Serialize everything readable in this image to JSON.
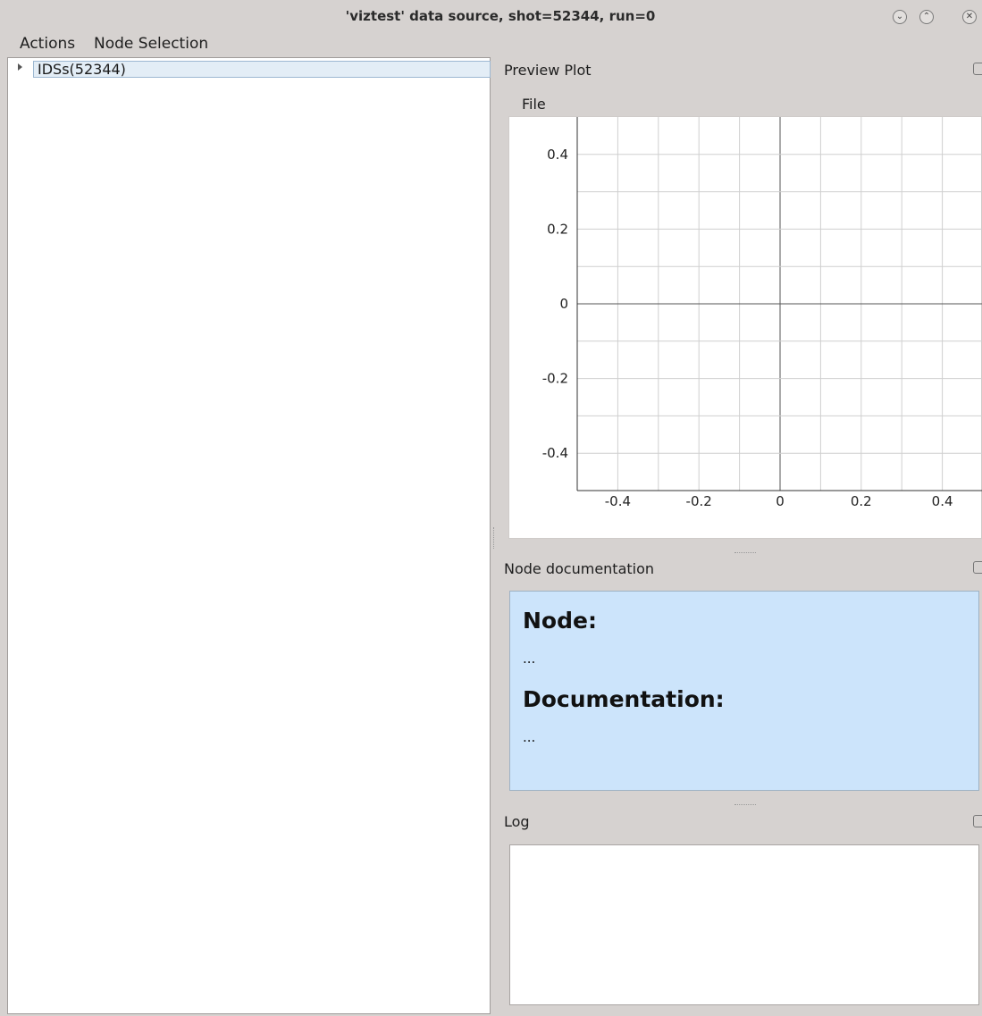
{
  "window": {
    "title": "'viztest' data source, shot=52344, run=0",
    "buttons": [
      "minimize",
      "maximize",
      "close"
    ]
  },
  "menubar": {
    "items": [
      "Actions",
      "Node Selection"
    ]
  },
  "tree": {
    "root_label": "IDSs(52344)",
    "expanded": false
  },
  "preview": {
    "title": "Preview Plot",
    "menu_file": "File"
  },
  "chart_data": {
    "type": "line",
    "title": "",
    "xlabel": "",
    "ylabel": "",
    "series": [],
    "xlim": [
      -0.5,
      0.5
    ],
    "ylim": [
      -0.5,
      0.5
    ],
    "x_ticks": [
      -0.4,
      -0.2,
      0,
      0.2,
      0.4
    ],
    "y_ticks": [
      -0.4,
      -0.2,
      0,
      0.2,
      0.4
    ],
    "x_tick_labels": [
      "-0.4",
      "-0.2",
      "0",
      "0.2",
      "0.4"
    ],
    "y_tick_labels": [
      "-0.4",
      "-0.2",
      "0",
      "0.2",
      "0.4"
    ],
    "grid": true
  },
  "doc": {
    "title": "Node documentation",
    "node_heading": "Node:",
    "node_value": "...",
    "doc_heading": "Documentation:",
    "doc_value": "..."
  },
  "log": {
    "title": "Log",
    "content": ""
  },
  "colors": {
    "background": "#d6d2d0",
    "doc_background": "#cce4fb",
    "tree_selection": "#e3edf6"
  }
}
